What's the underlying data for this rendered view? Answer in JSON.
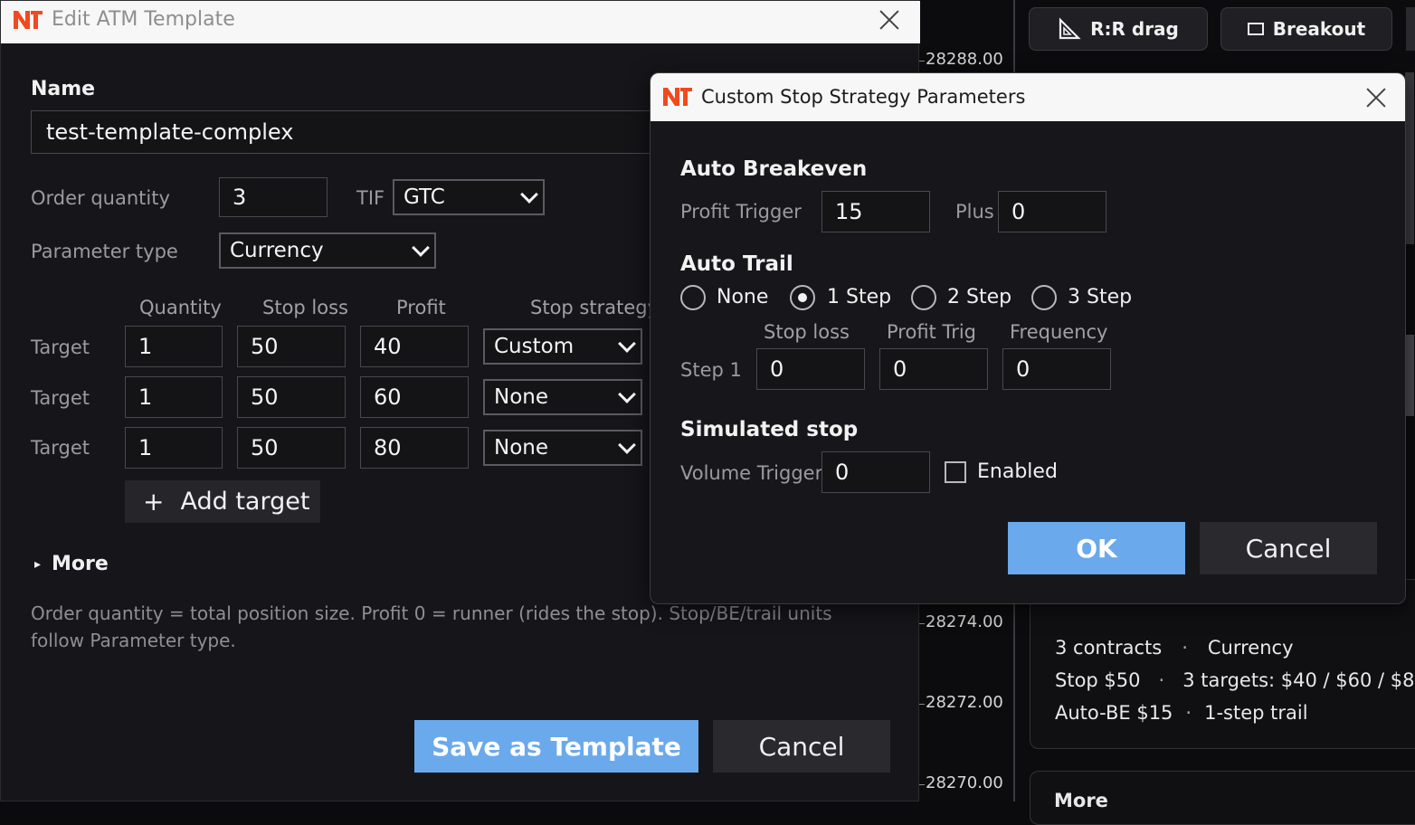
{
  "chart": {
    "prices": [
      "28288.00",
      "28274.00",
      "28272.00",
      "28270.00"
    ],
    "buttons": {
      "rr_drag": "R:R drag",
      "breakout": "Breakout"
    },
    "summary": {
      "line1_a": "3 contracts",
      "sep": "·",
      "line1_b": "Currency",
      "line2_a": "Stop $50",
      "line2_b": "3 targets: $40 / $60 / $8",
      "line3_a": "Auto-BE $15",
      "line3_b": "1-step trail"
    },
    "more_partial": "More"
  },
  "atm": {
    "title": "Edit ATM Template",
    "name_label": "Name",
    "name_value": "test-template-complex",
    "order_qty_label": "Order quantity",
    "order_qty_value": "3",
    "tif_label": "TIF",
    "tif_value": "GTC",
    "param_type_label": "Parameter type",
    "param_type_value": "Currency",
    "columns": {
      "quantity": "Quantity",
      "stop_loss": "Stop loss",
      "profit": "Profit",
      "stop_strategy": "Stop strategy"
    },
    "targets": [
      {
        "label": "Target",
        "quantity": "1",
        "stop_loss": "50",
        "profit": "40",
        "strategy": "Custom"
      },
      {
        "label": "Target",
        "quantity": "1",
        "stop_loss": "50",
        "profit": "60",
        "strategy": "None"
      },
      {
        "label": "Target",
        "quantity": "1",
        "stop_loss": "50",
        "profit": "80",
        "strategy": "None"
      }
    ],
    "add_target_icon": "+",
    "add_target": "Add target",
    "more_label": "More",
    "more_icon": "▸",
    "hint": "Order quantity = total position size. Profit 0 = runner (rides the stop). Stop/BE/trail units follow Parameter type.",
    "save_button": "Save as Template",
    "cancel_button": "Cancel"
  },
  "stop": {
    "title": "Custom Stop Strategy Parameters",
    "auto_breakeven": "Auto Breakeven",
    "profit_trigger_label": "Profit Trigger",
    "profit_trigger_value": "15",
    "plus_label": "Plus",
    "plus_value": "0",
    "auto_trail": "Auto Trail",
    "trail_options": [
      "None",
      "1 Step",
      "2 Step",
      "3 Step"
    ],
    "trail_selected": "1 Step",
    "step_columns": {
      "stop_loss": "Stop loss",
      "profit_trig": "Profit Trig",
      "frequency": "Frequency"
    },
    "step1_label": "Step 1",
    "step1": {
      "stop_loss": "0",
      "profit_trig": "0",
      "frequency": "0"
    },
    "simulated_stop": "Simulated stop",
    "volume_trigger_label": "Volume Trigger",
    "volume_trigger_value": "0",
    "enabled_label": "Enabled",
    "ok_button": "OK",
    "cancel_button": "Cancel"
  },
  "colors": {
    "accent": "#6aa9ec",
    "brand": "#f04a1e"
  }
}
